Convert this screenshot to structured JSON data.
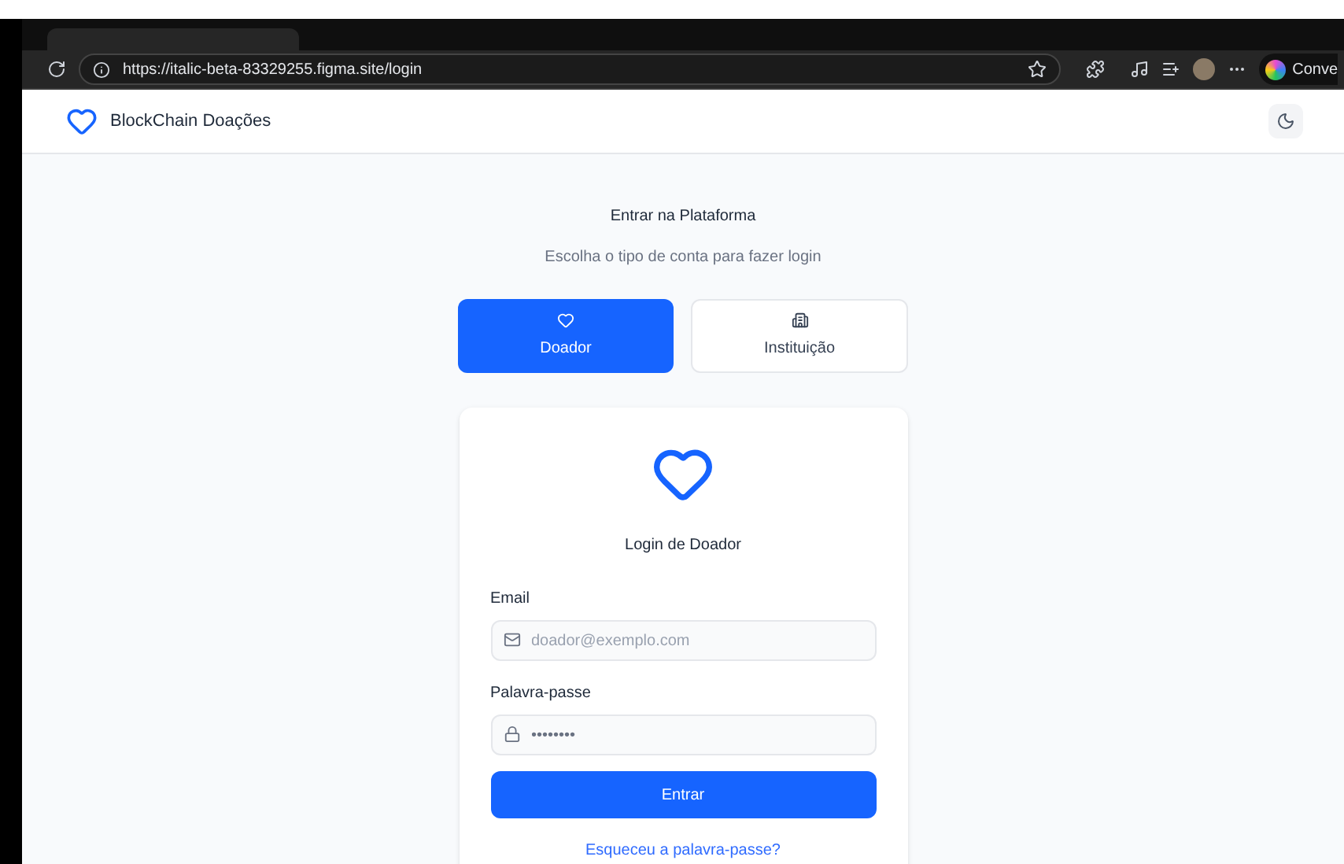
{
  "browser": {
    "url": "https://italic-beta-83329255.figma.site/login",
    "copilot_label": "Conve"
  },
  "header": {
    "brand": "BlockChain Doações"
  },
  "intro": {
    "title": "Entrar na Plataforma",
    "subtitle": "Escolha o tipo de conta para fazer login"
  },
  "account_types": [
    {
      "label": "Doador",
      "kind": "heart",
      "selected": true
    },
    {
      "label": "Instituição",
      "kind": "building",
      "selected": false
    }
  ],
  "login": {
    "title": "Login de Doador",
    "email": {
      "label": "Email",
      "placeholder": "doador@exemplo.com"
    },
    "password": {
      "label": "Palavra-passe",
      "placeholder": "••••••••"
    },
    "submit": "Entrar",
    "forgot": "Esqueceu a palavra-passe?"
  }
}
